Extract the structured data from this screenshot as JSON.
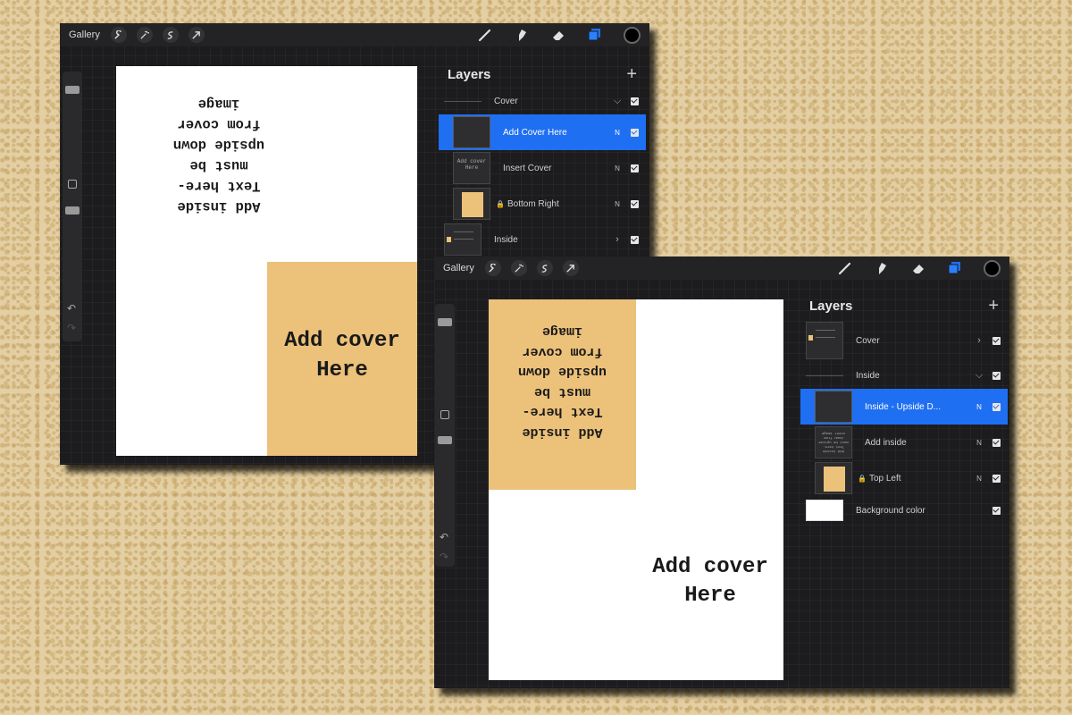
{
  "windows": [
    {
      "toolbar": {
        "gallery": "Gallery"
      },
      "layers": {
        "title": "Layers",
        "add": "+",
        "rows": [
          {
            "name": "Cover",
            "blend": "",
            "chevron": "⌵"
          },
          {
            "name": "Add Cover Here",
            "blend": "N",
            "chevron": ""
          },
          {
            "name": "Insert Cover",
            "blend": "N",
            "chevron": ""
          },
          {
            "name": "Bottom Right",
            "blend": "N",
            "chevron": ""
          },
          {
            "name": "Inside",
            "blend": "",
            "chevron": "›"
          }
        ]
      },
      "canvas": {
        "upside_text": "Add inside\nText here-\nmust be\nupside down\nfrom cover\nimage",
        "cover_text": "Add cover\nHere"
      }
    },
    {
      "toolbar": {
        "gallery": "Gallery"
      },
      "layers": {
        "title": "Layers",
        "add": "+",
        "rows": [
          {
            "name": "Cover",
            "blend": "",
            "chevron": "›"
          },
          {
            "name": "Inside",
            "blend": "",
            "chevron": "⌵"
          },
          {
            "name": "Inside - Upside D...",
            "blend": "N",
            "chevron": ""
          },
          {
            "name": "Add inside",
            "blend": "N",
            "chevron": ""
          },
          {
            "name": "Top Left",
            "blend": "N",
            "chevron": ""
          },
          {
            "name": "Background color",
            "blend": "",
            "chevron": ""
          }
        ]
      },
      "canvas": {
        "upside_text": "Add inside\nText here-\nmust be\nupside down\nfrom cover\nimage",
        "cover_text": "Add cover\nHere"
      }
    }
  ],
  "thumb_texts": {
    "add_cover": "Add cover Here",
    "add_inside": "Add inside Text here- must be upside down from cover image"
  },
  "colors": {
    "accent": "#1f6ff2",
    "tan": "#ecc17a",
    "panel": "#1c1c1e",
    "background": "#e3cfa3"
  }
}
